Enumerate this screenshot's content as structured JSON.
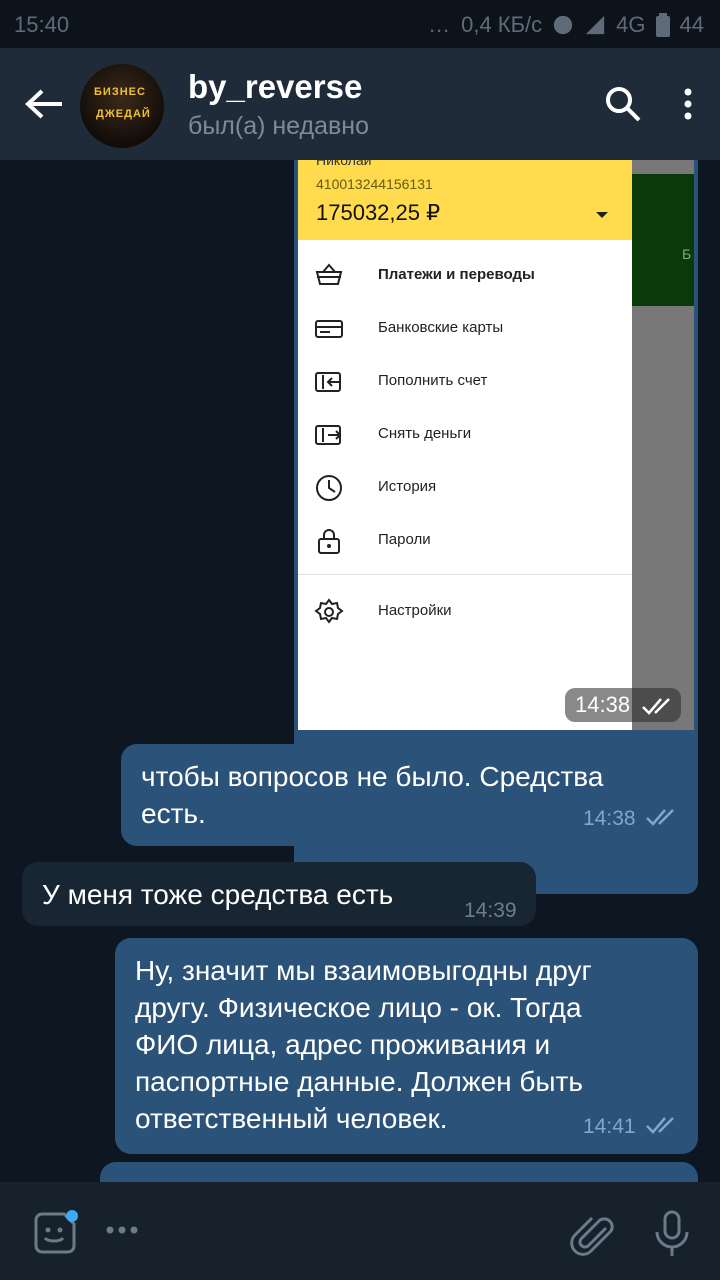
{
  "status_bar": {
    "time": "15:40",
    "dots": "…",
    "speed": "0,4 КБ/с",
    "network": "4G",
    "battery": "44"
  },
  "header": {
    "title": "by_reverse",
    "subtitle": "был(а) недавно",
    "avatar_text_1": "БИЗНЕС",
    "avatar_text_2": "ДЖЕДАЙ"
  },
  "image_message": {
    "drawer": {
      "name": "Николай",
      "account": "410013244156131",
      "balance": "175032,25 ₽",
      "items": [
        {
          "label": "Платежи и переводы",
          "icon": "basket-icon"
        },
        {
          "label": "Банковские карты",
          "icon": "card-icon"
        },
        {
          "label": "Пополнить счет",
          "icon": "topup-icon"
        },
        {
          "label": "Снять деньги",
          "icon": "withdraw-icon"
        },
        {
          "label": "История",
          "icon": "clock-icon"
        },
        {
          "label": "Пароли",
          "icon": "lock-icon"
        },
        {
          "label": "Настройки",
          "icon": "gear-icon"
        }
      ],
      "side_text": "Б"
    },
    "time": "14:38"
  },
  "messages": [
    {
      "direction": "out",
      "text_lines": [
        "чтобы вопросов не было. Средства",
        "есть."
      ],
      "time": "14:38"
    },
    {
      "direction": "in",
      "text_lines": [
        "У меня тоже средства есть"
      ],
      "time": "14:39"
    },
    {
      "direction": "out",
      "text_lines": [
        "Ну, значит мы взаимовыгодны друг",
        "другу. Физическое лицо - ок. Тогда",
        "ФИО лица, адрес проживания и",
        "паспортные данные. Должен быть",
        "ответственный человек."
      ],
      "time": "14:41"
    }
  ],
  "colors": {
    "accent": "#2b5278",
    "header": "#1f2b38",
    "background": "#0e1621",
    "incoming": "#182533",
    "check": "#7da8d3"
  }
}
